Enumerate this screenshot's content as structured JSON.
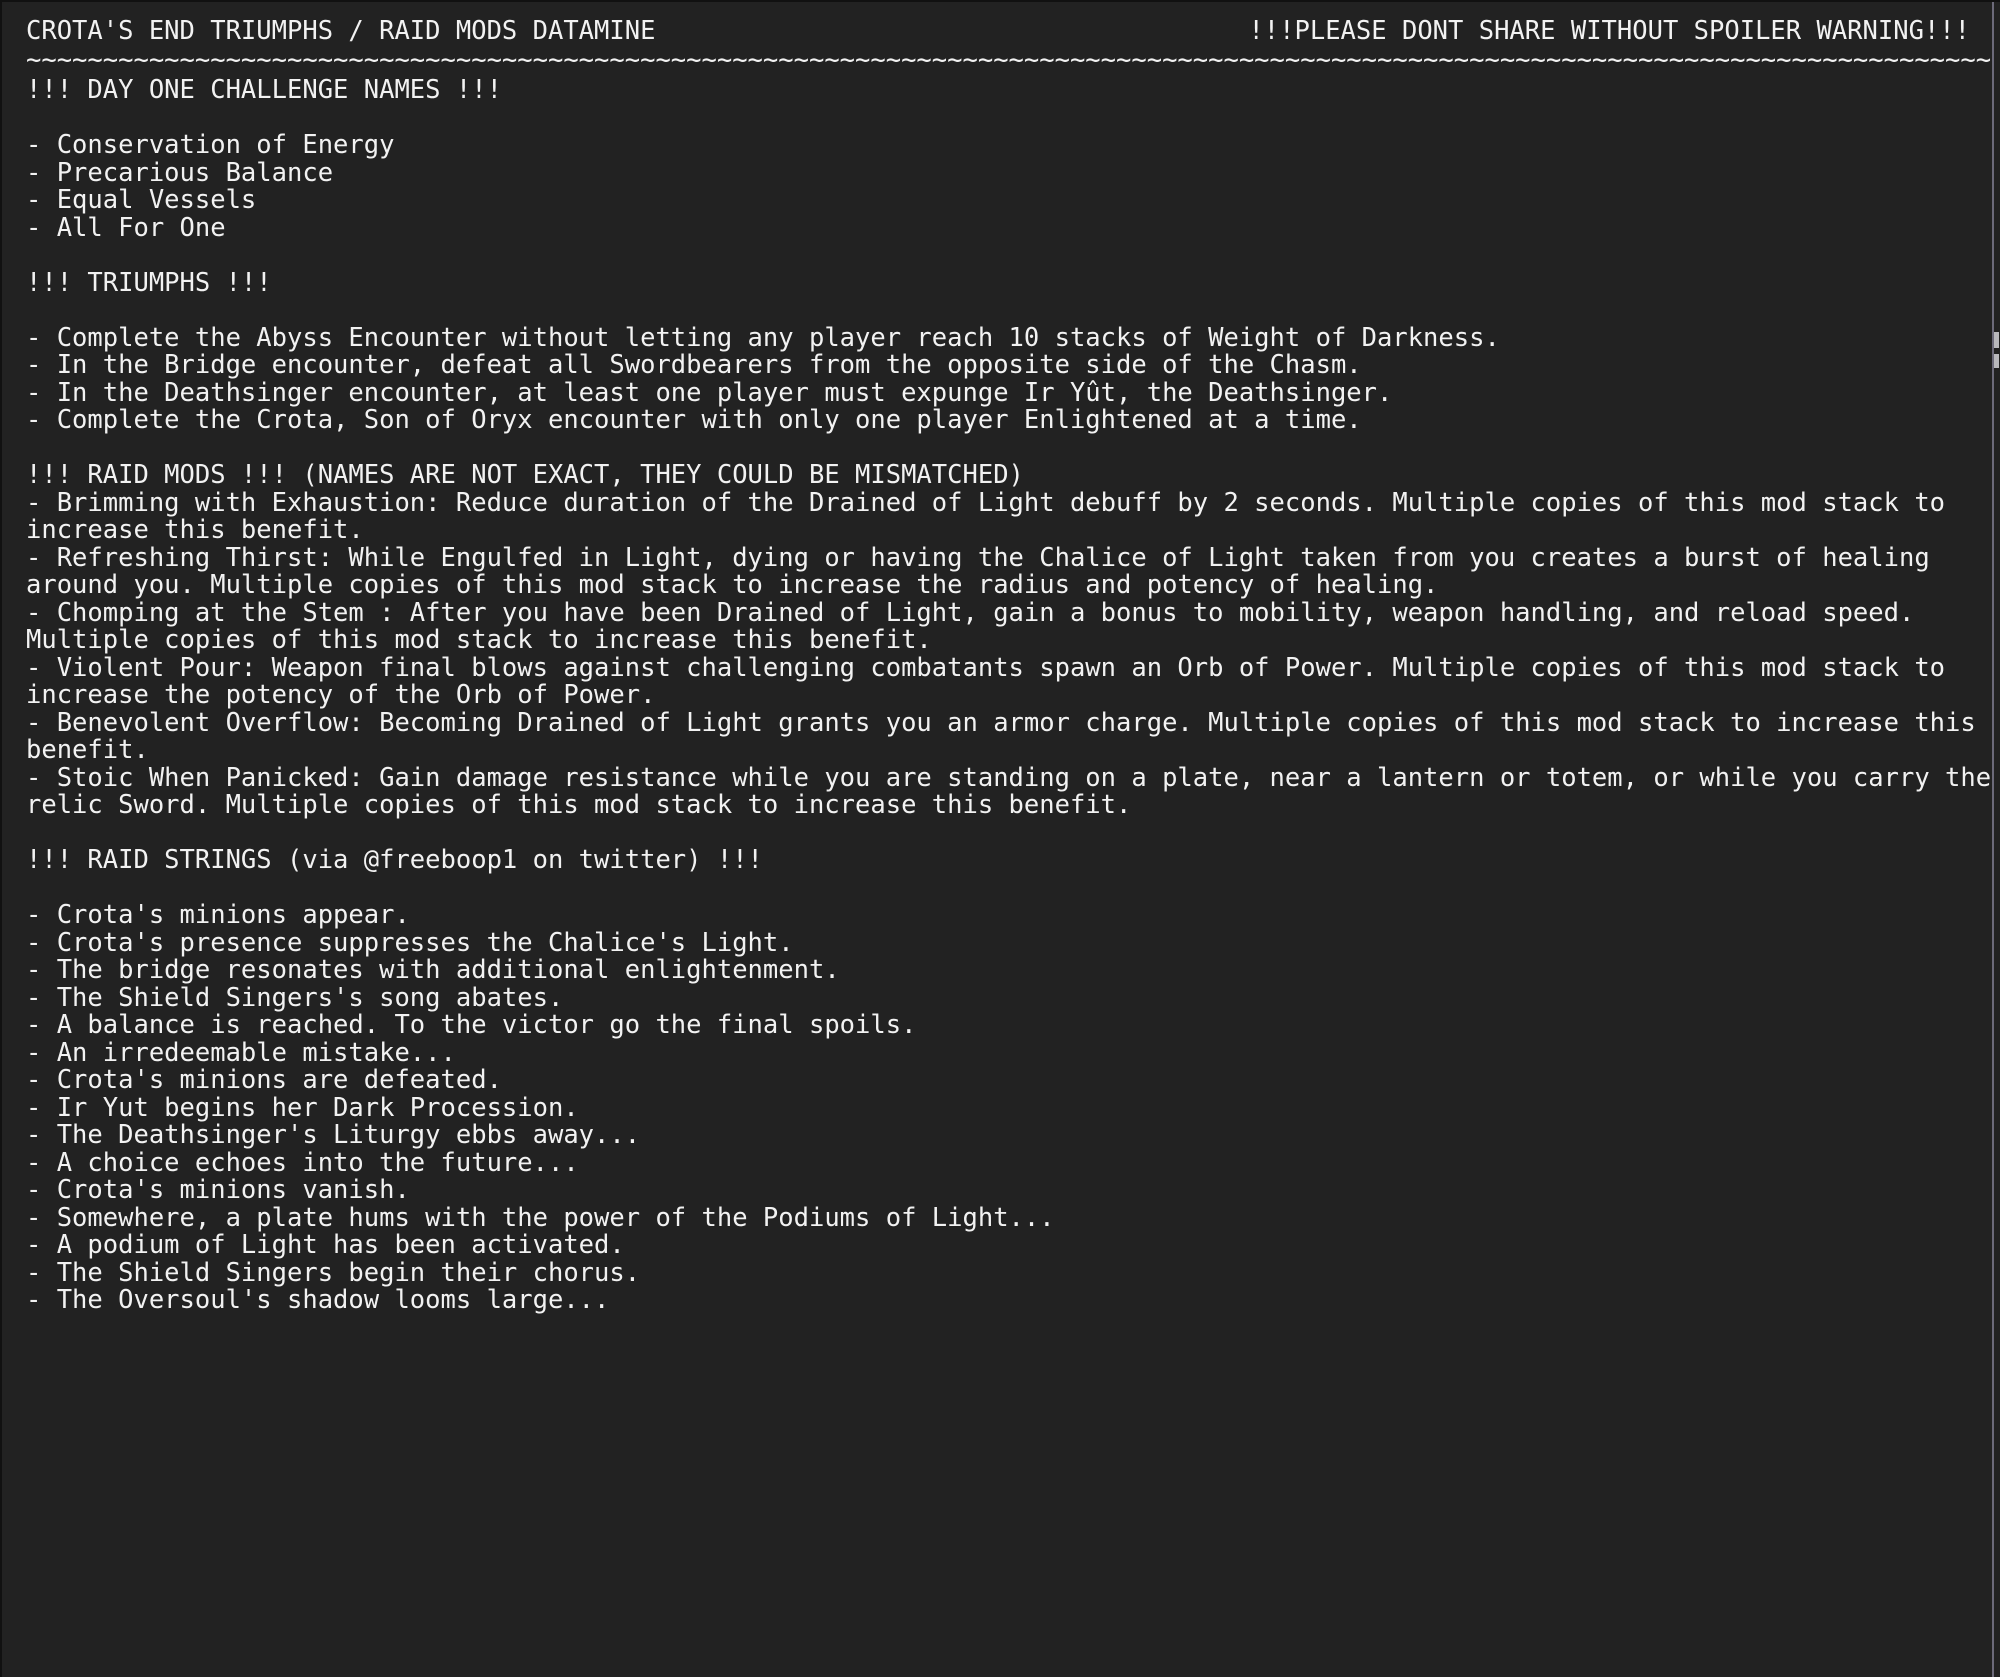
{
  "header": {
    "title": "CROTA'S END TRIUMPHS / RAID MODS DATAMINE",
    "warning": "!!!PLEASE DONT SHARE WITHOUT SPOILER WARNING!!!",
    "rule": "~~~~~~~~~~~~~~~~~~~~~~~~~~~~~~~~~~~~~~~~~~~~~~~~~~~~~~~~~~~~~~~~~~~~~~~~~~~~~~~~~~~~~~~~~~~~~~~~~~~~~~~~~~~~~~~~~~~~~~~~~~~~~~~~~~~~~~~~~~~~~~~~~~~~~~"
  },
  "sections": {
    "day_one": {
      "heading": "!!! DAY ONE CHALLENGE NAMES !!!",
      "items": [
        "- Conservation of Energy",
        "- Precarious Balance",
        "- Equal Vessels",
        "- All For One"
      ]
    },
    "triumphs": {
      "heading": "!!! TRIUMPHS !!!",
      "items": [
        "- Complete the Abyss Encounter without letting any player reach 10 stacks of Weight of Darkness.",
        "- In the Bridge encounter, defeat all Swordbearers from the opposite side of the Chasm.",
        "- In the Deathsinger encounter, at least one player must expunge Ir Yût, the Deathsinger.",
        "- Complete the Crota, Son of Oryx encounter with only one player Enlightened at a time."
      ]
    },
    "raid_mods": {
      "heading": "!!! RAID MODS !!! (NAMES ARE NOT EXACT, THEY COULD BE MISMATCHED)",
      "items": [
        "- Brimming with Exhaustion: Reduce duration of the Drained of Light debuff by 2 seconds. Multiple copies of this mod stack to increase this benefit.",
        "- Refreshing Thirst: While Engulfed in Light, dying or having the Chalice of Light taken from you creates a burst of healing around you. Multiple copies of this mod stack to increase the radius and potency of healing.",
        "- Chomping at the Stem : After you have been Drained of Light, gain a bonus to mobility, weapon handling, and reload speed. Multiple copies of this mod stack to increase this benefit.",
        "- Violent Pour: Weapon final blows against challenging combatants spawn an Orb of Power. Multiple copies of this mod stack to increase the potency of the Orb of Power.",
        "- Benevolent Overflow: Becoming Drained of Light grants you an armor charge. Multiple copies of this mod stack to increase this benefit.",
        "- Stoic When Panicked: Gain damage resistance while you are standing on a plate, near a lantern or totem, or while you carry the relic Sword. Multiple copies of this mod stack to increase this benefit."
      ]
    },
    "raid_strings": {
      "heading": "!!! RAID STRINGS (via @freeboop1 on twitter) !!!",
      "items": [
        "- Crota's minions appear.",
        "- Crota's presence suppresses the Chalice's Light.",
        "- The bridge resonates with additional enlightenment.",
        "- The Shield Singers's song abates.",
        "- A balance is reached. To the victor go the final spoils.",
        "- An irredeemable mistake...",
        "- Crota's minions are defeated.",
        "- Ir Yut begins her Dark Procession.",
        "- The Deathsinger's Liturgy ebbs away...",
        "- A choice echoes into the future...",
        "- Crota's minions vanish.",
        "- Somewhere, a plate hums with the power of the Podiums of Light...",
        "- A podium of Light has been activated.",
        "- The Shield Singers begin their chorus.",
        "- The Oversoul's shadow looms large..."
      ]
    }
  },
  "colors": {
    "background": "#222222",
    "text": "#f2f2f2",
    "frame": "#6c6a7a",
    "scrollbar_thumb": "#b9b9bd"
  }
}
